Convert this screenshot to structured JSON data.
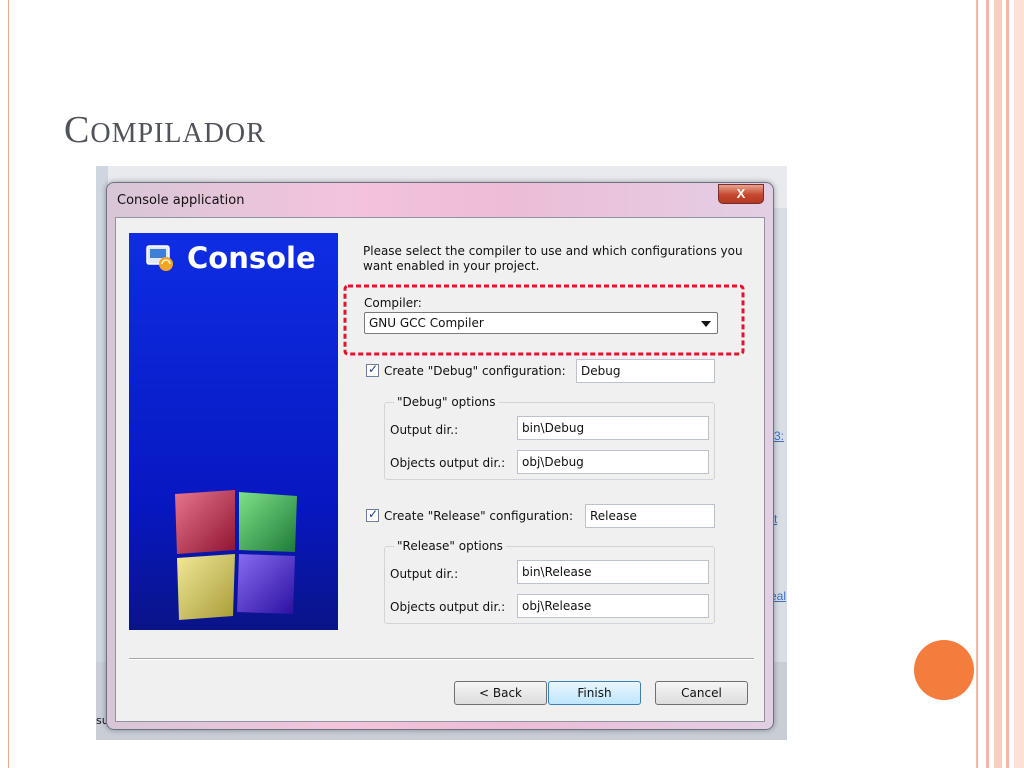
{
  "slide": {
    "title_first": "C",
    "title_rest": "ompilador"
  },
  "background": {
    "links": [
      "3:",
      "t",
      "eal"
    ],
    "status_fragment": "su"
  },
  "dialog": {
    "title": "Console application",
    "close_label": "X",
    "banner_title": "Console",
    "intro": "Please select the compiler to use and which configurations you want enabled in your project.",
    "compiler_label": "Compiler:",
    "compiler_value": "GNU GCC Compiler",
    "debug": {
      "checkbox_label": "Create \"Debug\" configuration:",
      "name": "Debug",
      "group_title": "\"Debug\" options",
      "output_label": "Output dir.:",
      "output_value": "bin\\Debug",
      "objects_label": "Objects output dir.:",
      "objects_value": "obj\\Debug"
    },
    "release": {
      "checkbox_label": "Create \"Release\" configuration:",
      "name": "Release",
      "group_title": "\"Release\" options",
      "output_label": "Output dir.:",
      "output_value": "bin\\Release",
      "objects_label": "Objects output dir.:",
      "objects_value": "obj\\Release"
    },
    "buttons": {
      "back": "< Back",
      "finish": "Finish",
      "cancel": "Cancel"
    }
  },
  "colors": {
    "accent_orange": "#f47c3c",
    "banner_blue": "#0717c0",
    "highlight_red": "#e0152a"
  }
}
